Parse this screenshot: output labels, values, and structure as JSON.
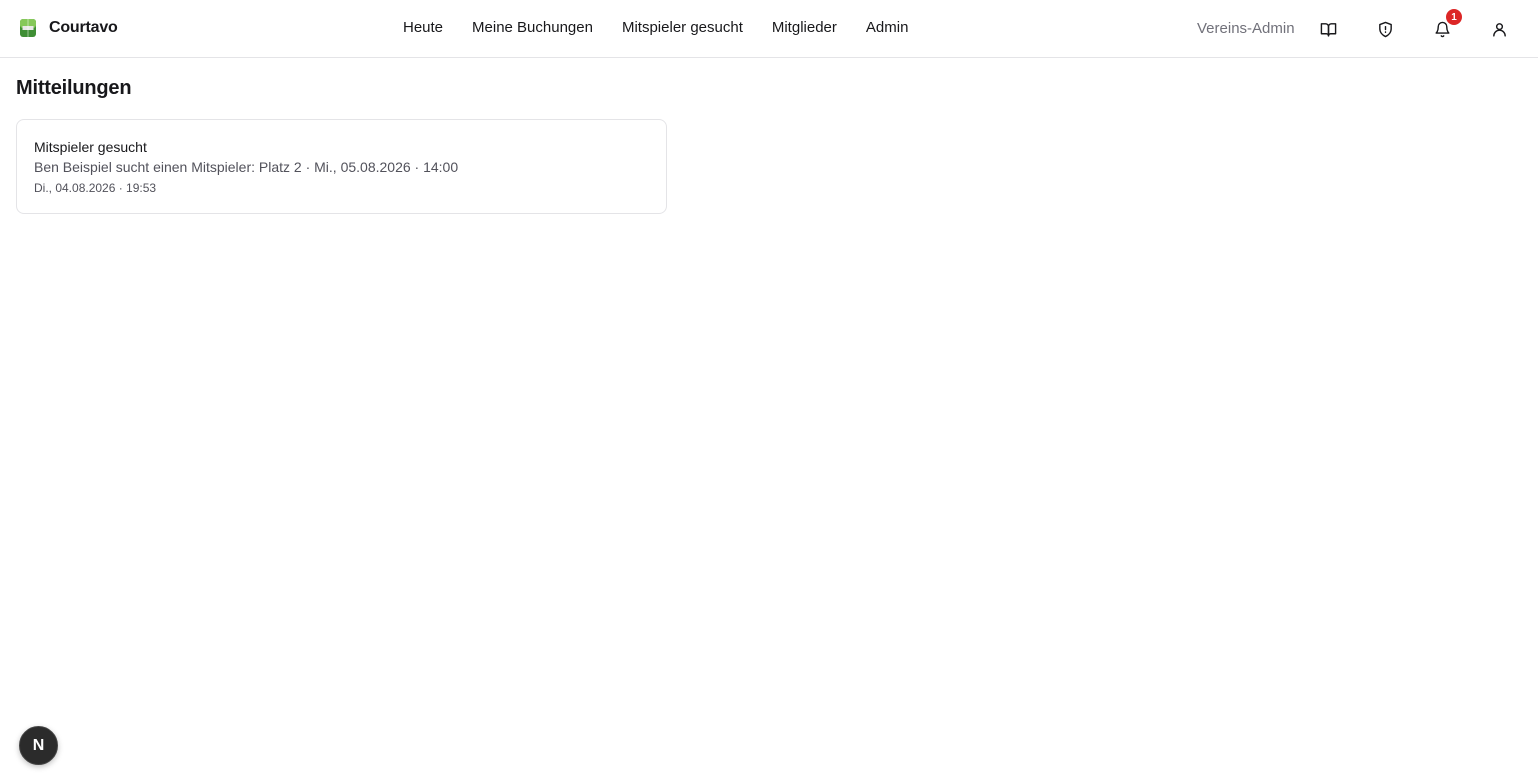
{
  "brand": {
    "name": "Courtavo",
    "logo_icon": "tennis-court-icon",
    "logo_colors": {
      "top": "#86c85a",
      "bottom": "#3f8f35"
    }
  },
  "nav": {
    "items": [
      {
        "label": "Heute"
      },
      {
        "label": "Meine Buchungen"
      },
      {
        "label": "Mitspieler gesucht"
      },
      {
        "label": "Mitglieder"
      },
      {
        "label": "Admin"
      }
    ]
  },
  "header": {
    "role_label": "Vereins-Admin",
    "icons": [
      "book-open-icon",
      "shield-icon",
      "bell-icon",
      "user-icon"
    ],
    "notification_count": "1",
    "badge_color": "#dc2626"
  },
  "page": {
    "title": "Mitteilungen"
  },
  "notifications": [
    {
      "title": "Mitspieler gesucht",
      "body": "Ben Beispiel sucht einen Mitspieler: Platz 2 · Mi., 05.08.2026 · 14:00",
      "time": "Di., 04.08.2026 · 19:53"
    }
  ],
  "dev_indicator": {
    "label": "N"
  }
}
